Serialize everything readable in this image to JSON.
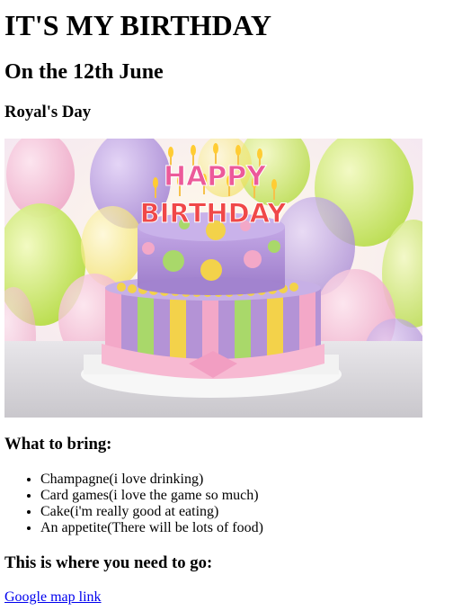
{
  "heading": "IT'S MY BIRTHDAY",
  "subheading": "On the 12th June",
  "tagline": "Royal's Day",
  "image": {
    "cake_text_top": "HAPPY",
    "cake_text_bottom": "BIRTHDAY",
    "colors": {
      "balloon_purple": "#b79ae0",
      "balloon_green": "#c8e85a",
      "balloon_yellow": "#f5e86a",
      "balloon_pink": "#f4b6cf",
      "cake_lavender": "#b493d6",
      "cake_pink": "#f3a8c8",
      "cake_green": "#a9d86a",
      "cake_yellow": "#f3d24a"
    }
  },
  "bring": {
    "heading": "What to bring:",
    "items": [
      "Champagne(i love drinking)",
      "Card games(i love the game so much)",
      "Cake(i'm really good at eating)",
      "An appetite(There will be lots of food)"
    ]
  },
  "location": {
    "heading": "This is where you need to go:",
    "link_label": "Google map link"
  }
}
